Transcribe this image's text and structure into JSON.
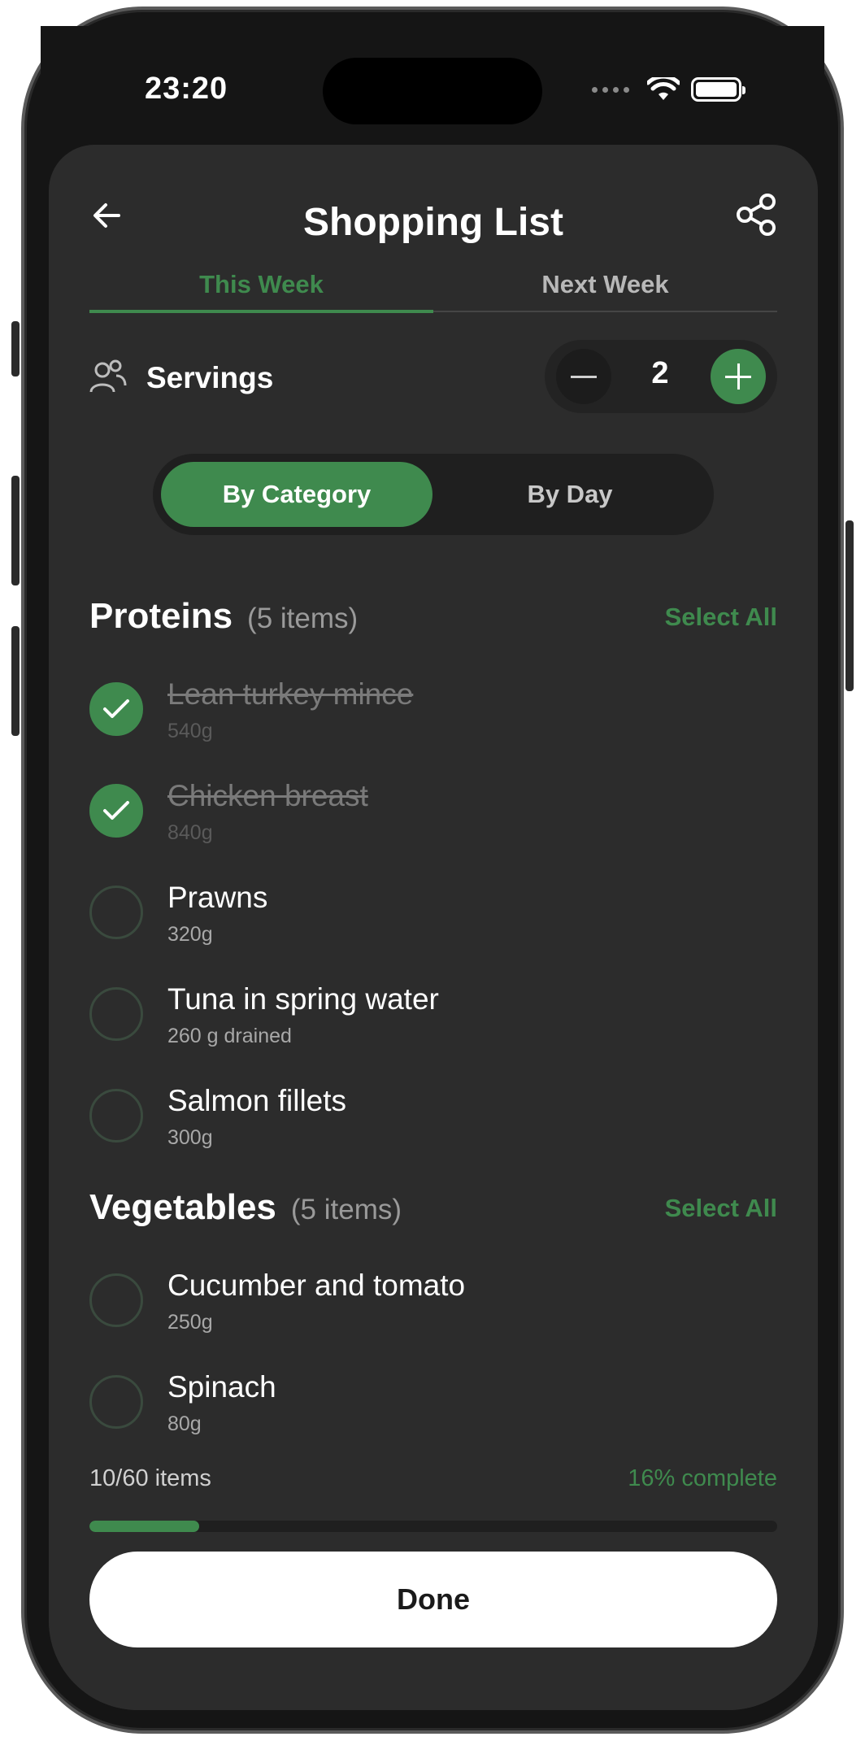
{
  "status_bar": {
    "time": "23:20"
  },
  "header": {
    "title": "Shopping List"
  },
  "tabs": [
    {
      "label": "This Week",
      "active": true
    },
    {
      "label": "Next Week",
      "active": false
    }
  ],
  "servings": {
    "label": "Servings",
    "value": "2"
  },
  "view_toggle": [
    {
      "label": "By Category",
      "active": true
    },
    {
      "label": "By Day",
      "active": false
    }
  ],
  "sections": [
    {
      "title": "Proteins",
      "count": "(5 items)",
      "action": "Select All",
      "items": [
        {
          "name": "Lean turkey mince",
          "qty": "540g",
          "checked": true
        },
        {
          "name": "Chicken breast",
          "qty": "840g",
          "checked": true
        },
        {
          "name": "Prawns",
          "qty": "320g",
          "checked": false
        },
        {
          "name": "Tuna in spring water",
          "qty": "260 g drained",
          "checked": false
        },
        {
          "name": "Salmon fillets",
          "qty": "300g",
          "checked": false
        }
      ]
    },
    {
      "title": "Vegetables",
      "count": "(5 items)",
      "action": "Select All",
      "items": [
        {
          "name": "Cucumber and tomato",
          "qty": "250g",
          "checked": false
        },
        {
          "name": "Spinach",
          "qty": "80g",
          "checked": false
        }
      ]
    }
  ],
  "progress": {
    "label": "10/60 items",
    "percent_label": "16% complete",
    "fraction": 0.16
  },
  "done_button": "Done",
  "colors": {
    "accent": "#3f8a4e",
    "background": "#2c2c2c",
    "bezel": "#151515"
  }
}
